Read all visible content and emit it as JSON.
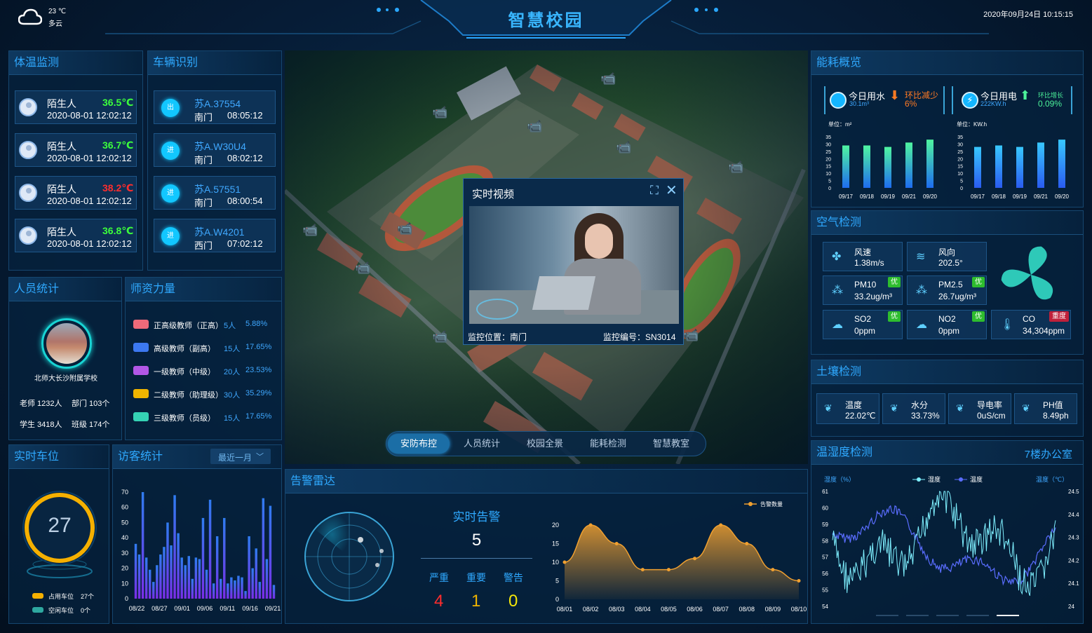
{
  "header": {
    "title": "智慧校园",
    "weather_temp": "23 ℃",
    "weather_desc": "多云",
    "datetime": "2020年09月24日 10:15:15"
  },
  "body_temp": {
    "title": "体温监测",
    "items": [
      {
        "name": "陌生人",
        "temp": "36.5℃",
        "time": "2020-08-01 12:02:12",
        "color": "#3cff3c"
      },
      {
        "name": "陌生人",
        "temp": "36.7℃",
        "time": "2020-08-01 12:02:12",
        "color": "#3cff3c"
      },
      {
        "name": "陌生人",
        "temp": "38.2℃",
        "time": "2020-08-01 12:02:12",
        "color": "#ff2d2d"
      },
      {
        "name": "陌生人",
        "temp": "36.8℃",
        "time": "2020-08-01 12:02:12",
        "color": "#3cff3c"
      }
    ]
  },
  "vehicle": {
    "title": "车辆识别",
    "items": [
      {
        "dir": "出",
        "plate": "苏A.37554",
        "gate": "南门",
        "time": "08:05:12"
      },
      {
        "dir": "进",
        "plate": "苏A.W30U4",
        "gate": "南门",
        "time": "08:02:12"
      },
      {
        "dir": "进",
        "plate": "苏A.57551",
        "gate": "南门",
        "time": "08:00:54"
      },
      {
        "dir": "进",
        "plate": "苏A.W4201",
        "gate": "西门",
        "time": "07:02:12"
      }
    ]
  },
  "personnel": {
    "title": "人员统计",
    "school": "北师大长沙附属学校",
    "teachers": "老师 1232人",
    "depts": "部门 103个",
    "students": "学生 3418人",
    "classes": "班级 174个"
  },
  "faculty": {
    "title": "师资力量",
    "items": [
      {
        "label": "正高级教师（正高）",
        "count": "5人",
        "pct": "5.88%",
        "color": "#ef6a7a"
      },
      {
        "label": "高级教师（副高）",
        "count": "15人",
        "pct": "17.65%",
        "color": "#3c78f0"
      },
      {
        "label": "一级教师（中级）",
        "count": "20人",
        "pct": "23.53%",
        "color": "#b257e6"
      },
      {
        "label": "二级教师（助理级）",
        "count": "30人",
        "pct": "35.29%",
        "color": "#f0b400"
      },
      {
        "label": "三级教师（员级）",
        "count": "15人",
        "pct": "17.65%",
        "color": "#35d2b4"
      }
    ]
  },
  "parking": {
    "title": "实时车位",
    "value": "27",
    "occupied_label": "占用车位",
    "occupied": "27个",
    "free_label": "空闲车位",
    "free": "0个"
  },
  "visitors": {
    "title": "访客统计",
    "filter": "最近一月",
    "chart_data": {
      "type": "bar",
      "ylim": [
        0,
        70
      ],
      "yticks": [
        "70",
        "60",
        "50",
        "40",
        "30",
        "20",
        "10",
        "0"
      ],
      "xticks": [
        "08/22",
        "08/27",
        "09/01",
        "09/06",
        "09/11",
        "09/16",
        "09/21"
      ],
      "values": [
        36,
        29,
        70,
        27,
        19,
        11,
        22,
        29,
        34,
        50,
        35,
        68,
        43,
        27,
        22,
        28,
        13,
        27,
        26,
        53,
        19,
        65,
        10,
        41,
        13,
        53,
        10,
        14,
        12,
        15,
        14,
        5,
        41,
        20,
        33,
        11,
        66,
        26,
        61,
        9
      ]
    }
  },
  "video": {
    "title": "实时视频",
    "location": "监控位置：南门",
    "code": "监控编号：SN3014"
  },
  "tabs": [
    {
      "label": "安防布控",
      "active": true
    },
    {
      "label": "人员统计",
      "active": false
    },
    {
      "label": "校园全景",
      "active": false
    },
    {
      "label": "能耗检测",
      "active": false
    },
    {
      "label": "智慧教室",
      "active": false
    }
  ],
  "alarm": {
    "title": "告警雷达",
    "realtime_label": "实时告警",
    "total": "5",
    "levels": [
      {
        "label": "严重",
        "value": "4",
        "color": "#ff2d2d"
      },
      {
        "label": "重要",
        "value": "1",
        "color": "#f0b400"
      },
      {
        "label": "警告",
        "value": "0",
        "color": "#f5e70a"
      }
    ],
    "chart_data": {
      "type": "area",
      "legend": "告警数量",
      "ylim": [
        0,
        20
      ],
      "yticks": [
        "20",
        "15",
        "10",
        "5",
        "0"
      ],
      "x": [
        "08/01",
        "08/02",
        "08/03",
        "08/04",
        "08/05",
        "08/06",
        "08/07",
        "08/08",
        "08/09",
        "08/10"
      ],
      "values": [
        10,
        20,
        15,
        8,
        8,
        11,
        20,
        15,
        8,
        5
      ]
    }
  },
  "energy": {
    "title": "能耗概览",
    "water": {
      "label": "今日用水",
      "value": "30.1m³",
      "trend": "环比减少",
      "trend_value": "6%",
      "unit": "单位：m²"
    },
    "power": {
      "label": "今日用电",
      "value": "222KW.h",
      "trend": "环比增长",
      "trend_value": "0.09%",
      "unit": "单位：KW.h"
    },
    "yticks": [
      "35",
      "30",
      "25",
      "20",
      "15",
      "10",
      "5",
      "0"
    ],
    "water_chart": {
      "type": "bar",
      "x": [
        "09/17",
        "09/18",
        "09/19",
        "09/21",
        "09/20"
      ],
      "values": [
        29,
        29,
        28,
        31,
        33
      ],
      "ylim": [
        0,
        35
      ]
    },
    "power_chart": {
      "type": "bar",
      "x": [
        "09/17",
        "09/18",
        "09/19",
        "09/21",
        "09/20"
      ],
      "values": [
        28,
        29,
        28,
        31,
        33
      ],
      "ylim": [
        0,
        35
      ]
    }
  },
  "air": {
    "title": "空气检测",
    "items": [
      {
        "label": "风速",
        "value": "1.38m/s",
        "badge": "",
        "icon": "wind-icon"
      },
      {
        "label": "风向",
        "value": "202.5°",
        "badge": "",
        "icon": "wind-direction-icon"
      },
      {
        "label": "PM10",
        "value": "33.2ug/m³",
        "badge": "优",
        "icon": "pm10-icon"
      },
      {
        "label": "PM2.5",
        "value": "26.7ug/m³",
        "badge": "优",
        "icon": "pm25-icon"
      },
      {
        "label": "SO2",
        "value": "0ppm",
        "badge": "优",
        "icon": "cloud-icon"
      },
      {
        "label": "NO2",
        "value": "0ppm",
        "badge": "优",
        "icon": "cloud-icon"
      },
      {
        "label": "CO",
        "value": "34,304ppm",
        "badge": "重度",
        "icon": "thermometer-icon"
      }
    ]
  },
  "soil": {
    "title": "土壤检测",
    "items": [
      {
        "label": "温度",
        "value": "22.02℃"
      },
      {
        "label": "水分",
        "value": "33.73%"
      },
      {
        "label": "导电率",
        "value": "0uS/cm"
      },
      {
        "label": "PH值",
        "value": "8.49ph"
      }
    ]
  },
  "humidity": {
    "title": "温湿度检测",
    "location": "7楼办公室",
    "left_unit": "湿度（%）",
    "right_unit": "温度（℃）",
    "legend_h": "湿度",
    "legend_t": "温度",
    "chart_data": {
      "type": "line",
      "left_ticks": [
        "61",
        "60",
        "59",
        "58",
        "57",
        "56",
        "55",
        "54"
      ],
      "right_ticks": [
        "24.5",
        "24.4",
        "24.3",
        "24.2",
        "24.1",
        "24"
      ]
    }
  }
}
